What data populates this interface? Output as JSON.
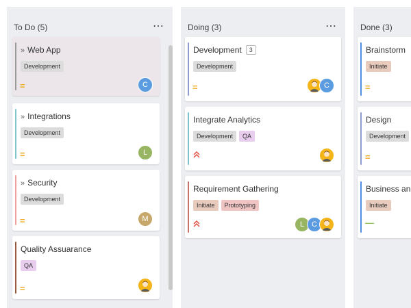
{
  "columns": [
    {
      "title": "To Do (5)",
      "more": "⋯",
      "cards": [
        {
          "title": "Web App",
          "tags": [
            {
              "label": "Development",
              "kind": "dev"
            }
          ],
          "priority_icon": "=",
          "avatars": [
            {
              "text": "C",
              "color": "#5b9be0"
            }
          ]
        },
        {
          "title": "Integrations",
          "tags": [
            {
              "label": "Development",
              "kind": "dev"
            }
          ],
          "priority_icon": "=",
          "avatars": [
            {
              "text": "L",
              "color": "#98b562"
            }
          ]
        },
        {
          "title": "Security",
          "tags": [
            {
              "label": "Development",
              "kind": "dev"
            }
          ],
          "priority_icon": "=",
          "avatars": [
            {
              "text": "M",
              "color": "#c7a86b"
            }
          ]
        },
        {
          "title": "Quality Assuarance",
          "tags": [
            {
              "label": "QA",
              "kind": "qa"
            }
          ],
          "priority_icon": "=",
          "avatars": [
            {
              "text": "",
              "face": true
            }
          ]
        }
      ]
    },
    {
      "title": "Doing (3)",
      "more": "⋯",
      "cards": [
        {
          "title": "Development",
          "count": "3",
          "tags": [
            {
              "label": "Development",
              "kind": "dev"
            }
          ],
          "priority_icon": "=",
          "avatars": [
            {
              "text": "",
              "face": true
            },
            {
              "text": "C",
              "color": "#5b9be0"
            }
          ]
        },
        {
          "title": "Integrate Analytics",
          "tags": [
            {
              "label": "Development",
              "kind": "dev"
            },
            {
              "label": "QA",
              "kind": "qa"
            }
          ],
          "priority_icon": "˄",
          "avatars": [
            {
              "text": "",
              "face": true
            }
          ]
        },
        {
          "title": "Requirement Gathering",
          "tags": [
            {
              "label": "Initiate",
              "kind": "init"
            },
            {
              "label": "Prototyping",
              "kind": "proto"
            }
          ],
          "priority_icon": "˄",
          "avatars": [
            {
              "text": "L",
              "color": "#98b562"
            },
            {
              "text": "C",
              "color": "#5b9be0"
            },
            {
              "text": "",
              "face": true
            }
          ]
        }
      ]
    },
    {
      "title": "Done (3)",
      "cards": [
        {
          "title": "Brainstorm",
          "tags": [
            {
              "label": "Initiate",
              "kind": "init"
            }
          ],
          "priority_icon": "="
        },
        {
          "title": "Design",
          "tags": [
            {
              "label": "Development",
              "kind": "dev"
            }
          ],
          "priority_icon": "="
        },
        {
          "title": "Business ana",
          "tags": [
            {
              "label": "Initiate",
              "kind": "init"
            }
          ],
          "priority_icon": "—"
        }
      ]
    }
  ],
  "colors": {
    "todo_accents": [
      "#9a9a9a",
      "#7ec4cf",
      "#f0a29a",
      "#9c5a3c"
    ],
    "doing_accents": [
      "#8d9bd0",
      "#7ec4cf",
      "#c9706b"
    ],
    "done_accents": [
      "#4f8ee0",
      "#8d9bd0",
      "#4f8ee0"
    ]
  }
}
